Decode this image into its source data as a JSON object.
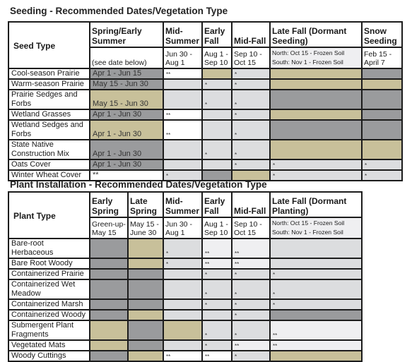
{
  "colors": {
    "dark": "#9a9b9d",
    "tan": "#c8c09a",
    "light": "#dcdddf",
    "vlight": "#efeff1",
    "white": "#ffffff",
    "border": "#1c1c1c"
  },
  "seeding": {
    "title": "Seeding - Recommended Dates/Vegetation Type",
    "row_header": "Seed Type",
    "columns": [
      {
        "label": "Spring/Early Summer",
        "dates": "(see date below)"
      },
      {
        "label": "Mid-Summer",
        "dates": "Jun 30 - Aug 1"
      },
      {
        "label": "Early Fall",
        "dates": "Aug 1 - Sep 10"
      },
      {
        "label": "Mid-Fall",
        "dates": "Sep 10 - Oct 15"
      },
      {
        "label": "Late Fall (Dormant Seeding)",
        "dates_north": "North: Oct 15 - Frozen Soil",
        "dates_south": "South: Nov 1 - Frozen Soil"
      },
      {
        "label": "Snow Seeding",
        "dates": "Feb 15 - April 7"
      }
    ],
    "rows": [
      {
        "name": "Cool-season Prairie",
        "cells": [
          {
            "color": "dark",
            "text": "Apr 1 - Jun 15"
          },
          {
            "color": "white",
            "text": "**"
          },
          {
            "color": "tan",
            "text": ""
          },
          {
            "color": "light",
            "text": "*"
          },
          {
            "color": "tan",
            "text": ""
          },
          {
            "color": "dark",
            "text": ""
          }
        ]
      },
      {
        "name": "Warm-season Prairie",
        "cells": [
          {
            "color": "dark",
            "text": "May 15 - Jun 30"
          },
          {
            "color": "light",
            "text": ""
          },
          {
            "color": "light",
            "text": "*"
          },
          {
            "color": "light",
            "text": "*"
          },
          {
            "color": "tan",
            "text": ""
          },
          {
            "color": "tan",
            "text": ""
          }
        ]
      },
      {
        "name": "Prairie Sedges and Forbs",
        "cells": [
          {
            "color": "tan",
            "text": "May 15 - Jun 30"
          },
          {
            "color": "light",
            "text": ""
          },
          {
            "color": "light",
            "text": "*"
          },
          {
            "color": "light",
            "text": "*"
          },
          {
            "color": "dark",
            "text": ""
          },
          {
            "color": "dark",
            "text": ""
          }
        ]
      },
      {
        "name": "Wetland Grasses",
        "cells": [
          {
            "color": "dark",
            "text": "Apr 1 - Jun 30"
          },
          {
            "color": "white",
            "text": "**"
          },
          {
            "color": "light",
            "text": ""
          },
          {
            "color": "light",
            "text": "*"
          },
          {
            "color": "tan",
            "text": ""
          },
          {
            "color": "dark",
            "text": ""
          }
        ]
      },
      {
        "name": "Wetland Sedges and Forbs",
        "cells": [
          {
            "color": "tan",
            "text": "Apr 1 - Jun 30"
          },
          {
            "color": "white",
            "text": "**"
          },
          {
            "color": "light",
            "text": ""
          },
          {
            "color": "light",
            "text": "*"
          },
          {
            "color": "dark",
            "text": ""
          },
          {
            "color": "dark",
            "text": ""
          }
        ]
      },
      {
        "name": "State Native Construction Mix",
        "cells": [
          {
            "color": "dark",
            "text": "Apr 1 - Jun 30"
          },
          {
            "color": "light",
            "text": ""
          },
          {
            "color": "light",
            "text": "*"
          },
          {
            "color": "light",
            "text": "*"
          },
          {
            "color": "tan",
            "text": ""
          },
          {
            "color": "tan",
            "text": ""
          }
        ]
      },
      {
        "name": "Oats Cover",
        "cells": [
          {
            "color": "dark",
            "text": "Apr 1 - Jun 30"
          },
          {
            "color": "light",
            "text": ""
          },
          {
            "color": "light",
            "text": ""
          },
          {
            "color": "light",
            "text": "*"
          },
          {
            "color": "light",
            "text": "*"
          },
          {
            "color": "light",
            "text": "*"
          }
        ]
      },
      {
        "name": "Winter Wheat Cover",
        "cells": [
          {
            "color": "white",
            "text": "**"
          },
          {
            "color": "light",
            "text": "*"
          },
          {
            "color": "dark",
            "text": ""
          },
          {
            "color": "tan",
            "text": ""
          },
          {
            "color": "light",
            "text": "*"
          },
          {
            "color": "light",
            "text": "*"
          }
        ]
      }
    ]
  },
  "planting": {
    "title": "Plant Installation - Recommended Dates/Vegetation Type",
    "row_header": "Plant Type",
    "columns": [
      {
        "label": "Early Spring",
        "dates": "Green-up-May 15"
      },
      {
        "label": "Late Spring",
        "dates": "May 15 - June 30"
      },
      {
        "label": "Mid-Summer",
        "dates": "Jun 30 - Aug 1"
      },
      {
        "label": "Early Fall",
        "dates": "Aug 1 - Sep 10"
      },
      {
        "label": "Mid-Fall",
        "dates": "Sep 10 - Oct 15"
      },
      {
        "label": "Late Fall (Dormant Planting)",
        "dates_north": "North: Oct 15 - Frozen Soil",
        "dates_south": "South: Nov 1 - Frozen Soil"
      }
    ],
    "rows": [
      {
        "name": "Bare-root Herbaceous",
        "cells": [
          {
            "color": "dark",
            "text": ""
          },
          {
            "color": "tan",
            "text": ""
          },
          {
            "color": "light",
            "text": "*"
          },
          {
            "color": "vlight",
            "text": "**"
          },
          {
            "color": "vlight",
            "text": "**"
          },
          {
            "color": "light",
            "text": ""
          }
        ]
      },
      {
        "name": "Bare Root Woody",
        "cells": [
          {
            "color": "dark",
            "text": ""
          },
          {
            "color": "tan",
            "text": ""
          },
          {
            "color": "light",
            "text": "*"
          },
          {
            "color": "vlight",
            "text": "**"
          },
          {
            "color": "vlight",
            "text": "**"
          },
          {
            "color": "light",
            "text": ""
          }
        ]
      },
      {
        "name": "Containerized Prairie",
        "cells": [
          {
            "color": "dark",
            "text": ""
          },
          {
            "color": "dark",
            "text": ""
          },
          {
            "color": "light",
            "text": ""
          },
          {
            "color": "light",
            "text": "*"
          },
          {
            "color": "light",
            "text": "*"
          },
          {
            "color": "light",
            "text": "*"
          }
        ]
      },
      {
        "name": "Containerized Wet Meadow",
        "cells": [
          {
            "color": "dark",
            "text": ""
          },
          {
            "color": "dark",
            "text": ""
          },
          {
            "color": "light",
            "text": ""
          },
          {
            "color": "light",
            "text": "*"
          },
          {
            "color": "light",
            "text": "*"
          },
          {
            "color": "light",
            "text": "*"
          }
        ]
      },
      {
        "name": "Containerized Marsh",
        "cells": [
          {
            "color": "dark",
            "text": ""
          },
          {
            "color": "dark",
            "text": ""
          },
          {
            "color": "light",
            "text": ""
          },
          {
            "color": "light",
            "text": "*"
          },
          {
            "color": "light",
            "text": "*"
          },
          {
            "color": "light",
            "text": "*"
          }
        ]
      },
      {
        "name": "Containerized Woody",
        "cells": [
          {
            "color": "dark",
            "text": ""
          },
          {
            "color": "tan",
            "text": ""
          },
          {
            "color": "light",
            "text": ""
          },
          {
            "color": "light",
            "text": ""
          },
          {
            "color": "light",
            "text": "*"
          },
          {
            "color": "dark",
            "text": ""
          }
        ]
      },
      {
        "name": "Submergent Plant Fragments",
        "cells": [
          {
            "color": "tan",
            "text": ""
          },
          {
            "color": "dark",
            "text": ""
          },
          {
            "color": "tan",
            "text": ""
          },
          {
            "color": "light",
            "text": "*"
          },
          {
            "color": "light",
            "text": "*"
          },
          {
            "color": "vlight",
            "text": "**"
          }
        ]
      },
      {
        "name": "Vegetated Mats",
        "cells": [
          {
            "color": "tan",
            "text": ""
          },
          {
            "color": "dark",
            "text": ""
          },
          {
            "color": "light",
            "text": ""
          },
          {
            "color": "light",
            "text": "*"
          },
          {
            "color": "vlight",
            "text": "**"
          },
          {
            "color": "vlight",
            "text": "**"
          }
        ]
      },
      {
        "name": "Woody Cuttings",
        "cells": [
          {
            "color": "dark",
            "text": ""
          },
          {
            "color": "tan",
            "text": ""
          },
          {
            "color": "white",
            "text": "**"
          },
          {
            "color": "white",
            "text": "**"
          },
          {
            "color": "light",
            "text": "*"
          },
          {
            "color": "tan",
            "text": ""
          }
        ]
      }
    ]
  }
}
